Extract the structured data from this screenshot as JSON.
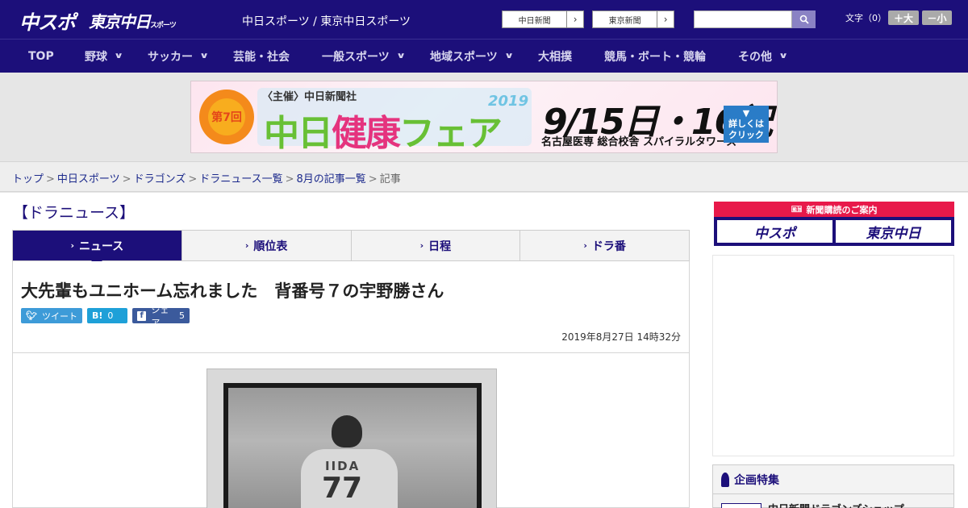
{
  "header": {
    "logo_chuspo": "中スポ",
    "logo_tokyo": "東京中日",
    "logo_tokyo_small": "スポーツ",
    "site_name": "中日スポーツ / 東京中日スポーツ",
    "paper_links": [
      "中日新聞",
      "東京新聞"
    ],
    "search": {
      "placeholder": ""
    },
    "font_size_label": "文字（0）",
    "size_big": "＋大",
    "size_small": "－小"
  },
  "nav": {
    "items": [
      {
        "label": "TOP",
        "has_menu": false
      },
      {
        "label": "野球",
        "has_menu": true
      },
      {
        "label": "サッカー",
        "has_menu": true
      },
      {
        "label": "芸能・社会",
        "has_menu": false
      },
      {
        "label": "一般スポーツ",
        "has_menu": true
      },
      {
        "label": "地域スポーツ",
        "has_menu": true
      },
      {
        "label": "大相撲",
        "has_menu": false
      },
      {
        "label": "競馬・ボート・競輪",
        "has_menu": false
      },
      {
        "label": "その他",
        "has_menu": true
      }
    ]
  },
  "banner": {
    "badge": "第7回",
    "host": "〈主催〉中日新聞社",
    "title_part1": "中日",
    "title_part2": "健康",
    "title_part3": "フェア",
    "year": "2019",
    "date": "9/15日・16祝",
    "venue": "名古屋医専 総合校舎 スパイラルタワーズ",
    "more_line1": "詳しくは",
    "more_line2": "クリック"
  },
  "breadcrumb": {
    "items": [
      "トップ",
      "中日スポーツ",
      "ドラゴンズ",
      "ドラニュース一覧",
      "8月の記事一覧"
    ],
    "current": "記事",
    "separator": ">"
  },
  "section_title": "【ドラニュース】",
  "tabs": [
    {
      "label": "ニュース",
      "active": true
    },
    {
      "label": "順位表",
      "active": false
    },
    {
      "label": "日程",
      "active": false
    },
    {
      "label": "ドラ番",
      "active": false
    }
  ],
  "article": {
    "headline": "大先輩もユニホーム忘れました　背番号７の宇野勝さん",
    "share": {
      "tweet_label": "ツイート",
      "hatena_icon": "B!",
      "hatena_count": "0",
      "facebook_label": "シェア",
      "facebook_count": "5"
    },
    "pubdate": "2019年8月27日 14時32分",
    "photo_name": "IIDA",
    "photo_number": "77"
  },
  "sidebar": {
    "subscribe_header": "新聞購読のご案内",
    "subscribe_chuspo": "中スポ",
    "subscribe_tokyo": "東京中日",
    "feature_title": "企画特集",
    "feature_item": "中日新聞ドラゴンズショップ"
  },
  "colors": {
    "brand_navy": "#1c0f7a",
    "accent_red": "#e8194a",
    "twitter": "#3d9bd8",
    "hatena": "#1ea0d8",
    "facebook": "#3b5a9c"
  }
}
